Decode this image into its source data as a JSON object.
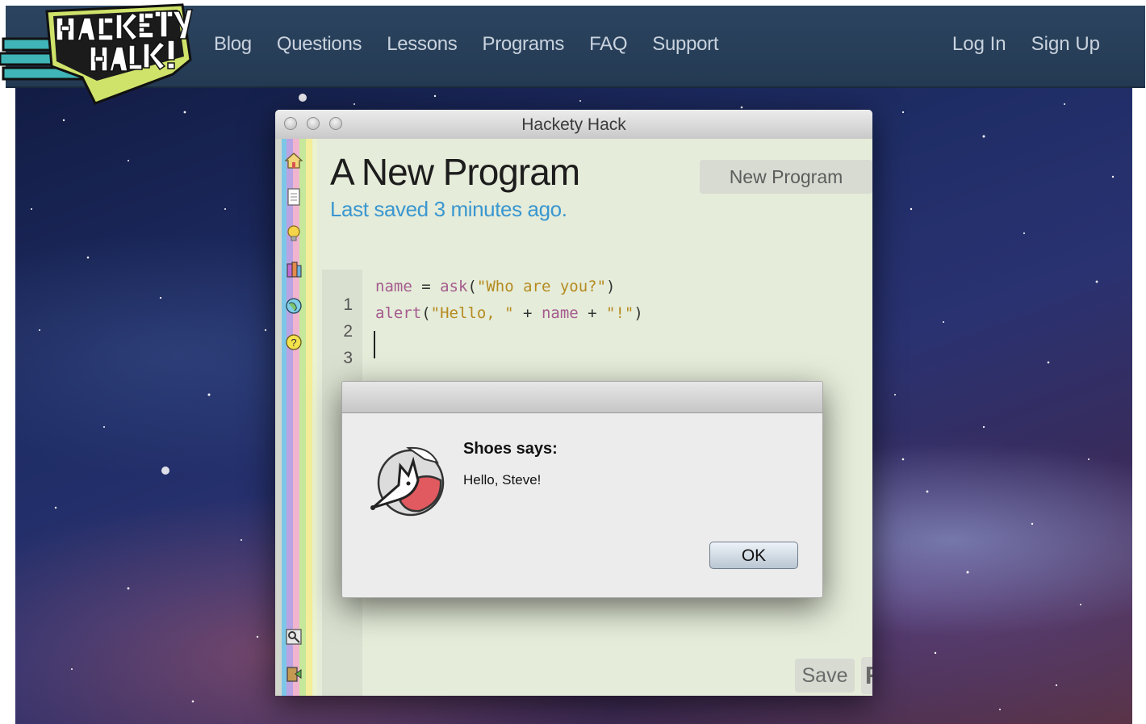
{
  "nav": {
    "links": [
      "Blog",
      "Questions",
      "Lessons",
      "Programs",
      "FAQ",
      "Support"
    ],
    "login": "Log In",
    "signup": "Sign Up"
  },
  "window": {
    "title": "Hackety Hack"
  },
  "editor": {
    "program_title": "A New Program",
    "last_saved": "Last saved 3 minutes ago.",
    "new_program_button": "New Program",
    "save_button": "Save",
    "run_button": "Run",
    "lines": [
      {
        "number": "1"
      },
      {
        "number": "2"
      },
      {
        "number": "3"
      }
    ],
    "code_tokens": {
      "l1_var": "name",
      "l1_op": " = ",
      "l1_fn": "ask",
      "l1_open": "(",
      "l1_str": "\"Who are you?\"",
      "l1_close": ")",
      "l2_fn": "alert",
      "l2_open": "(",
      "l2_str1": "\"Hello, \"",
      "l2_plus1": " + ",
      "l2_var": "name",
      "l2_plus2": " + ",
      "l2_str2": "\"!\"",
      "l2_close": ")"
    }
  },
  "dialog": {
    "heading": "Shoes says:",
    "message": "Hello, Steve!",
    "ok_button": "OK"
  },
  "icons": {
    "sidebar": [
      "home-icon",
      "document-icon",
      "lightbulb-icon",
      "books-icon",
      "globe-icon",
      "help-icon",
      "preferences-icon",
      "exit-icon"
    ]
  },
  "colors": {
    "navbar": "#243a53",
    "nav_text": "#c9d3de",
    "editor_bg": "#e5ecd9",
    "last_saved": "#3a97d0",
    "code_keyword": "#a55b8e",
    "code_string": "#b58a1f"
  }
}
